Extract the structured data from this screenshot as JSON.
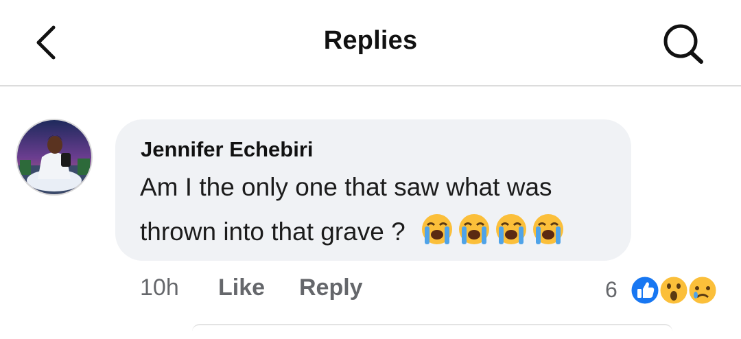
{
  "header": {
    "title": "Replies",
    "back_icon": "chevron-left-icon",
    "search_icon": "search-icon"
  },
  "comment": {
    "author": "Jennifer Echebiri",
    "text_line1": "Am I the only one that saw what was",
    "text_line2": "thrown into that grave ?",
    "emoji_icons": [
      "loudly-crying-face-icon",
      "loudly-crying-face-icon",
      "loudly-crying-face-icon",
      "loudly-crying-face-icon"
    ],
    "time": "10h",
    "like_label": "Like",
    "reply_label": "Reply",
    "reaction_count": "6",
    "reaction_icons": [
      "like-reaction-icon",
      "wow-reaction-icon",
      "sad-reaction-icon"
    ]
  },
  "colors": {
    "bubble": "#f0f2f5",
    "meta_text": "#65676b",
    "like_blue": "#1877f2",
    "emoji_yellow": "#fbbf3a"
  }
}
